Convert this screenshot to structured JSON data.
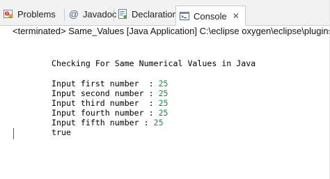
{
  "tabs": [
    {
      "label": "Problems",
      "icon": "problems-icon"
    },
    {
      "label": "Javadoc",
      "icon": "at-icon"
    },
    {
      "label": "Declaration",
      "icon": "declaration-icon"
    },
    {
      "label": "Console",
      "icon": "console-icon",
      "active": true
    }
  ],
  "status": "<terminated> Same_Values [Java Application] C:\\eclipse oxygen\\eclipse\\plugins\\org.eclip",
  "console": {
    "heading": "Checking For Same Numerical Values in Java",
    "lines": [
      {
        "prompt": "Input first number  : ",
        "value": "25"
      },
      {
        "prompt": "Input second number : ",
        "value": "25"
      },
      {
        "prompt": "Input third number  : ",
        "value": "25"
      },
      {
        "prompt": "Input fourth number : ",
        "value": "25"
      },
      {
        "prompt": "Input fifth number : ",
        "value": "25"
      }
    ],
    "result": "true"
  },
  "colors": {
    "input_value": "#1d8a4a"
  }
}
